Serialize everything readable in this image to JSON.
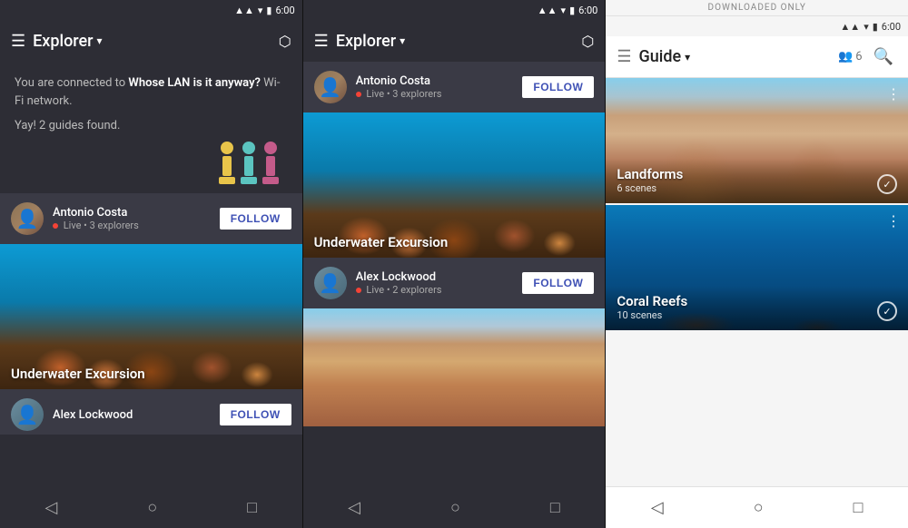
{
  "panels": {
    "left": {
      "statusBar": {
        "time": "6:00",
        "icons": [
          "signal",
          "wifi",
          "battery"
        ]
      },
      "toolbar": {
        "menuIcon": "☰",
        "title": "Explorer",
        "caret": "▾",
        "vrIcon": "⬡"
      },
      "wifiMessage": {
        "prefix": "You are connected to ",
        "network": "Whose LAN is it anyway?",
        "suffix": " Wi-Fi network."
      },
      "guidesFound": "Yay! 2 guides found.",
      "guide1": {
        "name": "Antonio Costa",
        "status": "Live",
        "explorers": "3 explorers",
        "followLabel": "FOLLOW",
        "caption": "Underwater Excursion"
      },
      "guide2": {
        "name": "Alex Lockwood",
        "followLabel": "FOLLOW"
      }
    },
    "mid": {
      "statusBar": {
        "time": "6:00"
      },
      "toolbar": {
        "menuIcon": "☰",
        "title": "Explorer",
        "caret": "▾",
        "vrIcon": "⬡"
      },
      "guide1": {
        "name": "Antonio Costa",
        "status": "Live",
        "explorers": "3 explorers",
        "followLabel": "FOLLOW",
        "caption": "Underwater Excursion"
      },
      "guide2": {
        "name": "Alex Lockwood",
        "status": "Live",
        "explorers": "2 explorers",
        "followLabel": "FOLLOW"
      }
    },
    "right": {
      "statusBar": {
        "time": "6:00"
      },
      "downloadedBanner": "DOWNLOADED ONLY",
      "toolbar": {
        "menuIcon": "☰",
        "title": "Guide",
        "caret": "▾",
        "peopleCount": "6",
        "searchIcon": "🔍"
      },
      "guide1": {
        "title": "Landforms",
        "scenes": "6 scenes",
        "hasCheck": true
      },
      "guide2": {
        "title": "Coral Reefs",
        "scenes": "10 scenes",
        "hasCheck": true
      }
    }
  },
  "nav": {
    "back": "◁",
    "home": "○",
    "square": "□"
  }
}
